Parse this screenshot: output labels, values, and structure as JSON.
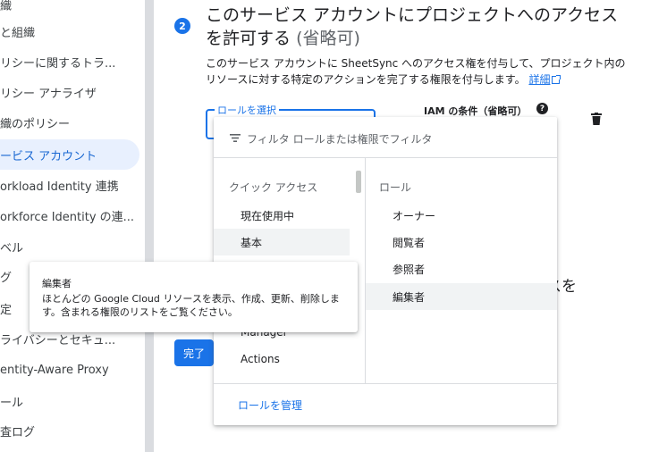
{
  "sidebar": {
    "items": [
      {
        "label": "織"
      },
      {
        "label": "と組織"
      },
      {
        "label": "リシーに関するトラ..."
      },
      {
        "label": "リシー アナライザ"
      },
      {
        "label": "織のポリシー"
      },
      {
        "label": "ービス アカウント"
      },
      {
        "label": "orkload Identity 連携"
      },
      {
        "label": "orkforce Identity の連..."
      },
      {
        "label": "ベル"
      },
      {
        "label": "グ"
      },
      {
        "label": "定"
      },
      {
        "label": "ライバシーとセキュ..."
      },
      {
        "label": "entity-Aware Proxy"
      },
      {
        "label": "ール"
      },
      {
        "label": "査ログ"
      }
    ],
    "active_index": 5
  },
  "step": {
    "number": "2",
    "title_main": "このサービス アカウントにプロジェクトへのアクセスを許可する",
    "title_optional": "(省略可)",
    "description": "このサービス アカウントに SheetSync へのアクセス権を付与して、プロジェクト内のリソースに対する特定のアクションを完了する権限を付与します。",
    "details_link": "詳細"
  },
  "role_select": {
    "label": "ロールを選択"
  },
  "iam_condition_label": "IAM の条件（省略可）",
  "help_icon_glyph": "?",
  "background_text_access": "セスを",
  "done_button": "完了",
  "dropdown": {
    "filter_placeholder": "フィルタ ロールまたは権限でフィルタ",
    "left_header": "クイック アクセス",
    "left_items": [
      {
        "label": "現在使用中"
      },
      {
        "label": "基本"
      },
      {
        "label": "Manager"
      },
      {
        "label": "Actions"
      }
    ],
    "right_header": "ロール",
    "right_items": [
      {
        "label": "オーナー"
      },
      {
        "label": "閲覧者"
      },
      {
        "label": "参照者"
      },
      {
        "label": "編集者"
      }
    ],
    "manage_roles": "ロールを管理"
  },
  "tooltip": {
    "title": "編集者",
    "body": "ほとんどの Google Cloud リソースを表示、作成、更新、削除します。含まれる権限のリストをご覧ください。"
  },
  "colors": {
    "accent": "#1a73e8",
    "active_bg": "#e8f0fe",
    "hover_bg": "#f1f3f4"
  }
}
